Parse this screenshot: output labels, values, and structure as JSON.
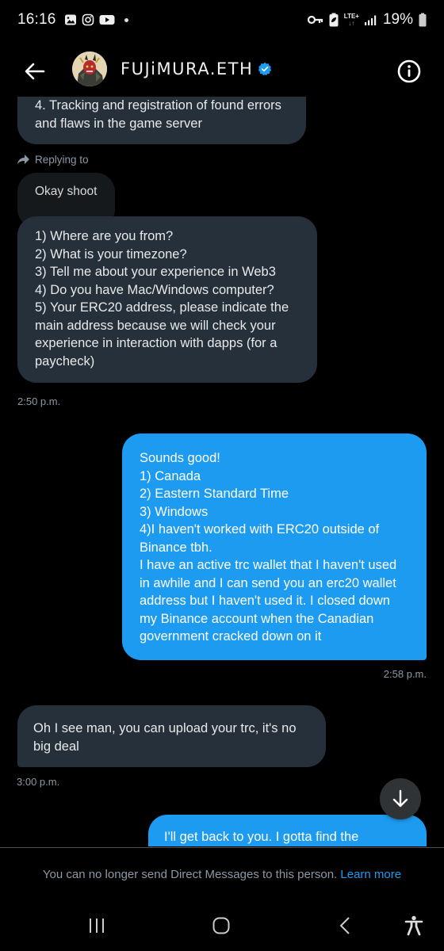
{
  "status_bar": {
    "time": "16:16",
    "left_icons": [
      "gallery-icon",
      "instagram-icon",
      "youtube-icon",
      "notification-dot-icon"
    ],
    "right_icons": [
      "vpn-key-icon",
      "battery-saver-icon",
      "lte-icon",
      "signal-icon",
      "battery-icon"
    ],
    "network": "LTE+",
    "battery_percent": "19%"
  },
  "header": {
    "back_icon": "arrow-left-icon",
    "contact_name": "FUJiMURA.ETH",
    "verified": true,
    "verified_color": "#1d9bf0",
    "info_icon": "info-icon"
  },
  "messages": [
    {
      "direction": "incoming",
      "text": "4. Tracking and registration of found errors\nand flaws in the game server",
      "partial": true
    },
    {
      "direction": "incoming",
      "reply_label": "Replying to",
      "reply_quote": "Okay shoot",
      "text": "1) Where are you from?\n2) What is your timezone?\n3) Tell me about your experience in Web3\n4) Do you have Mac/Windows computer?\n5) Your ERC20 address, please indicate the\nmain address because we will check your\nexperience in interaction with dapps (for a\npaycheck)",
      "time": "2:50 p.m."
    },
    {
      "direction": "outgoing",
      "text": "Sounds good!\n1) Canada\n2) Eastern Standard Time\n3) Windows\n4)I haven't worked with ERC20 outside of\nBinance tbh.\nI have an active trc wallet that I haven't used\nin awhile and I can send you an erc20 wallet\naddress but I haven't used it. I closed down\nmy Binance account when the Canadian\ngovernment cracked down on it",
      "time": "2:58 p.m."
    },
    {
      "direction": "incoming",
      "text": "Oh I see man, you can upload your trc, it's no\nbig deal",
      "time": "3:00 p.m."
    },
    {
      "direction": "outgoing",
      "text": "I'll get back to you. I gotta find the",
      "partial": true
    }
  ],
  "scroll_to_bottom_icon": "arrow-down-icon",
  "notice": {
    "text": "You can no longer send Direct Messages to this person.",
    "link": "Learn more"
  },
  "colors": {
    "accent": "#1d9bf0",
    "incoming_bubble": "#26303a",
    "background": "#000000"
  },
  "nav_bar": {
    "buttons": [
      "recent-apps-icon",
      "home-icon",
      "back-icon",
      "accessibility-icon"
    ]
  }
}
